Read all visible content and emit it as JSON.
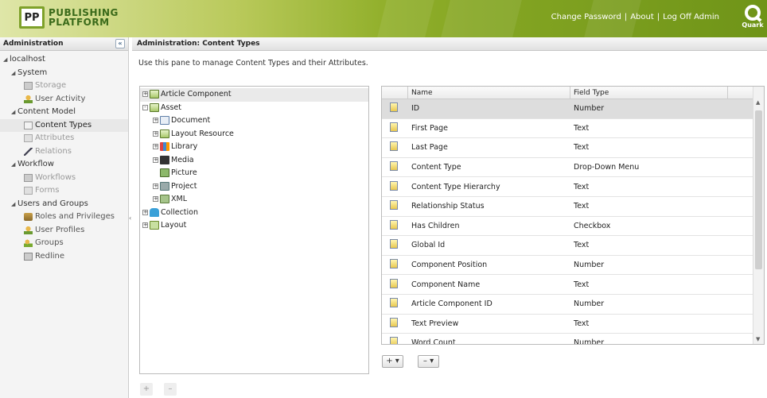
{
  "header": {
    "logo_mark": "PP",
    "logo_line1": "PUBLISHING",
    "logo_line2": "PLATFORM",
    "links": [
      "Change Password",
      "About",
      "Log Off Admin"
    ],
    "quark_label": "Quark"
  },
  "left": {
    "title": "Administration",
    "collapse_glyph": "«",
    "items": [
      {
        "label": "localhost",
        "level": 0,
        "expanded": true
      },
      {
        "label": "System",
        "level": 1,
        "expanded": true
      },
      {
        "label": "Storage",
        "level": 2,
        "icon": "storage-icon",
        "disabled": true
      },
      {
        "label": "User Activity",
        "level": 2,
        "icon": "user-activity-icon"
      },
      {
        "label": "Content Model",
        "level": 1,
        "expanded": true
      },
      {
        "label": "Content Types",
        "level": 2,
        "icon": "content-types-icon",
        "selected": true
      },
      {
        "label": "Attributes",
        "level": 2,
        "icon": "attributes-icon",
        "disabled": true
      },
      {
        "label": "Relations",
        "level": 2,
        "icon": "relations-icon",
        "disabled": true
      },
      {
        "label": "Workflow",
        "level": 1,
        "expanded": true
      },
      {
        "label": "Workflows",
        "level": 2,
        "icon": "workflows-icon",
        "disabled": true
      },
      {
        "label": "Forms",
        "level": 2,
        "icon": "forms-icon",
        "disabled": true
      },
      {
        "label": "Users and Groups",
        "level": 1,
        "expanded": true
      },
      {
        "label": "Roles and Privileges",
        "level": 2,
        "icon": "roles-icon"
      },
      {
        "label": "User Profiles",
        "level": 2,
        "icon": "user-profiles-icon"
      },
      {
        "label": "Groups",
        "level": 2,
        "icon": "groups-icon"
      },
      {
        "label": "Redline",
        "level": 2,
        "icon": "redline-icon"
      }
    ]
  },
  "main": {
    "title": "Administration: Content Types",
    "description": "Use this pane to manage Content Types and their Attributes."
  },
  "content_types": [
    {
      "label": "Article Component",
      "indent": 0,
      "toggle": "+",
      "icon": "article-component-icon",
      "selected": true
    },
    {
      "label": "Asset",
      "indent": 0,
      "toggle": "-",
      "icon": "asset-icon"
    },
    {
      "label": "Document",
      "indent": 1,
      "toggle": "+",
      "icon": "document-icon"
    },
    {
      "label": "Layout Resource",
      "indent": 1,
      "toggle": "+",
      "icon": "layout-resource-icon"
    },
    {
      "label": "Library",
      "indent": 1,
      "toggle": "+",
      "icon": "library-icon"
    },
    {
      "label": "Media",
      "indent": 1,
      "toggle": "+",
      "icon": "media-icon"
    },
    {
      "label": "Picture",
      "indent": 1,
      "toggle": "",
      "icon": "picture-icon"
    },
    {
      "label": "Project",
      "indent": 1,
      "toggle": "+",
      "icon": "project-icon"
    },
    {
      "label": "XML",
      "indent": 1,
      "toggle": "+",
      "icon": "xml-icon"
    },
    {
      "label": "Collection",
      "indent": 0,
      "toggle": "+",
      "icon": "collection-icon"
    },
    {
      "label": "Layout",
      "indent": 0,
      "toggle": "+",
      "icon": "layout-icon"
    }
  ],
  "grid": {
    "columns": [
      "",
      "Name",
      "Field Type"
    ],
    "rows": [
      {
        "name": "ID",
        "type": "Number",
        "selected": true
      },
      {
        "name": "First Page",
        "type": "Text"
      },
      {
        "name": "Last Page",
        "type": "Text"
      },
      {
        "name": "Content Type",
        "type": "Drop-Down Menu"
      },
      {
        "name": "Content Type Hierarchy",
        "type": "Text"
      },
      {
        "name": "Relationship Status",
        "type": "Text"
      },
      {
        "name": "Has Children",
        "type": "Checkbox"
      },
      {
        "name": "Global Id",
        "type": "Text"
      },
      {
        "name": "Component Position",
        "type": "Number"
      },
      {
        "name": "Component Name",
        "type": "Text"
      },
      {
        "name": "Article Component ID",
        "type": "Number"
      },
      {
        "name": "Text Preview",
        "type": "Text"
      },
      {
        "name": "Word Count",
        "type": "Number"
      }
    ]
  },
  "buttons": {
    "add_attribute": "+ ▾",
    "remove_attribute": "– ▾",
    "tree_add": "+",
    "tree_remove": "–"
  }
}
